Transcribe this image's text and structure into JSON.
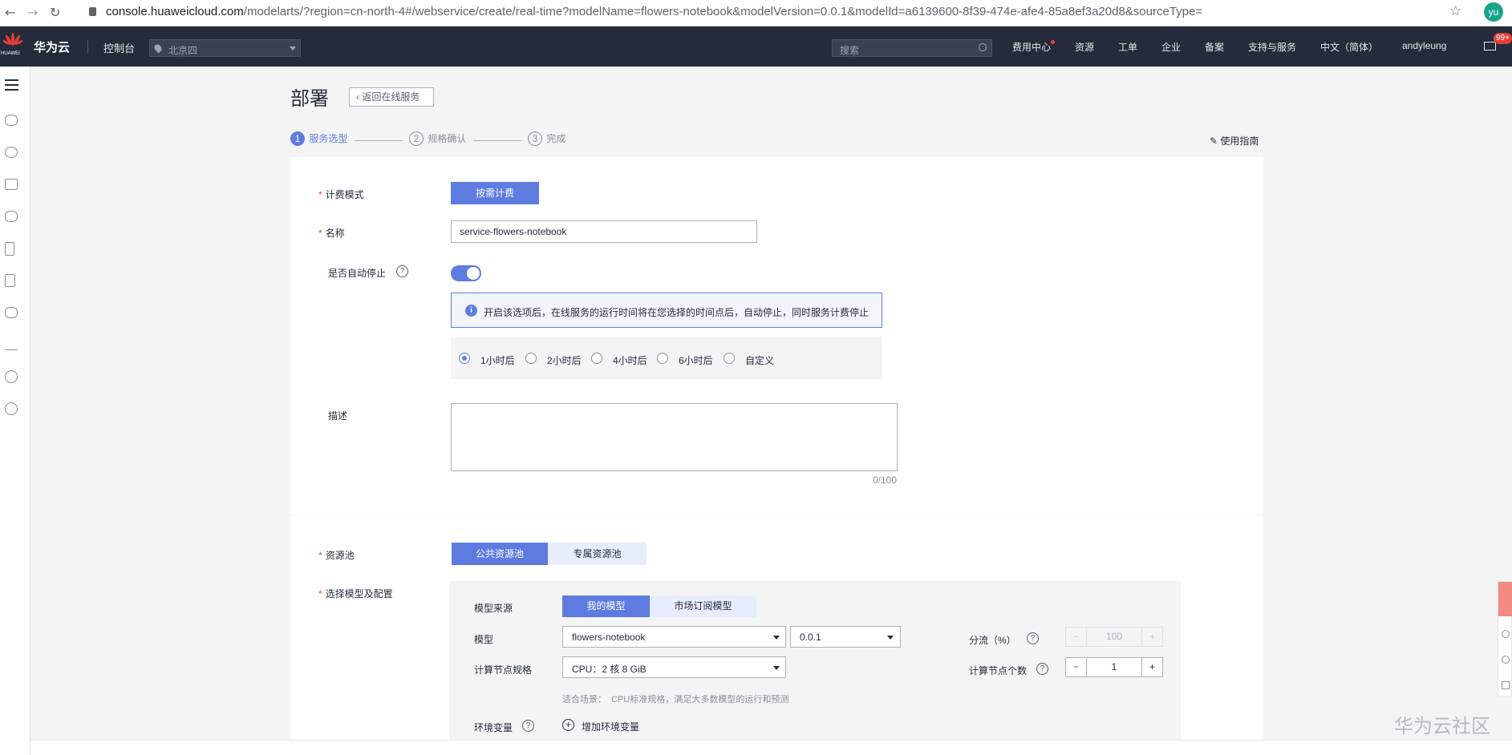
{
  "browser": {
    "url_host": "console.huaweicloud.com",
    "url_path": "/modelarts/?region=cn-north-4#/webservice/create/real-time?modelName=flowers-notebook&modelVersion=0.0.1&modelId=a6139600-8f39-474e-afe4-85a8ef3a20d8&sourceType=",
    "profile_initials": "yu"
  },
  "topbar": {
    "brand_sub": "HUAWEI",
    "brand": "华为云",
    "console": "控制台",
    "region": "北京四",
    "search_placeholder": "搜索",
    "menu": [
      "费用中心",
      "资源",
      "工单",
      "企业",
      "备案",
      "支持与服务",
      "中文（简体）",
      "andyleung"
    ],
    "mail_badge": "99+"
  },
  "page": {
    "title": "部署",
    "back_label": "返回在线服务",
    "steps": [
      {
        "num": "1",
        "label": "服务选型"
      },
      {
        "num": "2",
        "label": "规格确认"
      },
      {
        "num": "3",
        "label": "完成"
      }
    ],
    "guide": "使用指南"
  },
  "form": {
    "billing_label": "计费模式",
    "billing_value": "按需计费",
    "name_label": "名称",
    "name_value": "service-flowers-notebook",
    "autostop_label": "是否自动停止",
    "autostop_on": true,
    "autostop_info": "开启该选项后，在线服务的运行时间将在您选择的时间点后，自动停止，同时服务计费停止",
    "autostop_options": [
      "1小时后",
      "2小时后",
      "4小时后",
      "6小时后",
      "自定义"
    ],
    "autostop_selected": "1小时后",
    "desc_label": "描述",
    "desc_counter": "0/100",
    "pool_label": "资源池",
    "pool_public": "公共资源池",
    "pool_private": "专属资源池",
    "model_config_label": "选择模型及配置",
    "source_label": "模型来源",
    "source_mine": "我的模型",
    "source_market": "市场订阅模型",
    "model_label": "模型",
    "model_value": "flowers-notebook",
    "version_value": "0.0.1",
    "split_label": "分流（%）",
    "split_value": "100",
    "spec_label": "计算节点规格",
    "spec_value": "CPU：2 核 8 GiB",
    "node_count_label": "计算节点个数",
    "node_count_value": "1",
    "spec_hint": "适合场景：  CPU标准规格，满足大多数模型的运行和预测",
    "env_label": "环境变量",
    "env_add": "增加环境变量"
  },
  "watermark": "华为云社区",
  "colors": {
    "primary": "#5e7ce0",
    "navbar": "#252b3a",
    "required": "#e3403a"
  }
}
